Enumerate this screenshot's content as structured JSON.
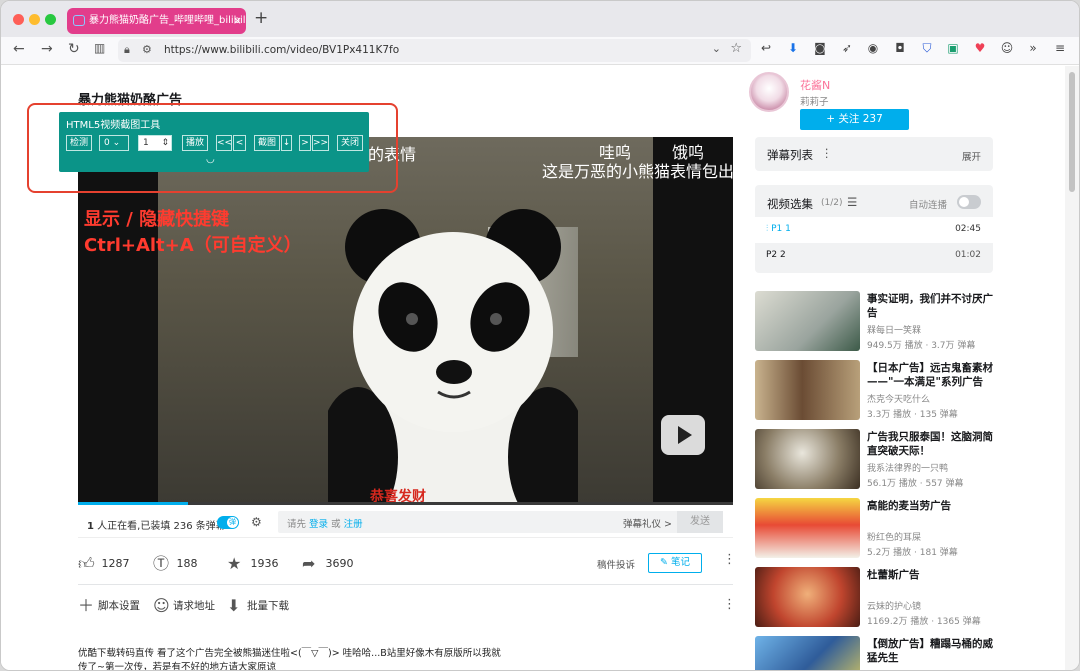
{
  "browser": {
    "tab_title": "暴力熊猫奶酪广告_哔哩哔哩_bilibili",
    "tab_close": "×",
    "new_tab": "+",
    "url": "https://www.bilibili.com/video/BV1Px411K7fo"
  },
  "video": {
    "title": "暴力熊猫奶酪广告",
    "subtitles": {
      "top_mid": "哇呜",
      "top_right": "饿呜",
      "line": "这是万恶的小熊猫表情包出",
      "left_partial": "的表情"
    },
    "hint_line1": "显示 / 隐藏快捷键",
    "hint_line2": "Ctrl+Alt+A（可自定义）",
    "danmaku": "恭喜发财"
  },
  "tool": {
    "title": "HTML5视频截图工具",
    "detect": "检测",
    "select_value": "0",
    "step_value": "1",
    "play": "播放",
    "prev2": "<<",
    "prev1": "<",
    "capture": "截图",
    "down": "↓",
    "next1": ">",
    "next2": ">>",
    "close": "关闭"
  },
  "player_bar": {
    "watching_prefix": "1",
    "watching_text": " 人正在看,已装填 236 条弹幕",
    "input_pre": "请先",
    "login": "登录",
    "or": "或",
    "register": "注册",
    "gift": "弹幕礼仪 >",
    "send": "发送"
  },
  "stats": {
    "like": "1287",
    "coin": "188",
    "fav": "1936",
    "share": "3690",
    "report": "稿件投诉",
    "note": "笔记"
  },
  "extra": {
    "script": "脚本设置",
    "request": "请求地址",
    "batch": "批量下载"
  },
  "description": "优酷下载转码直传 看了这个广告完全被熊猫迷住啦<(￣▽￣)> 哇哈哈...B站里好像木有原版所以我就传了~第一次传，若是有不好的地方请大家原谅",
  "up": {
    "name": "花酱N",
    "sub": "莉莉子",
    "follow": "+ 关注 237"
  },
  "danmaku_list": {
    "title": "弹幕列表",
    "expand": "展开"
  },
  "episodes": {
    "title": "视频选集",
    "count": "(1/2)",
    "autoplay": "自动连播",
    "items": [
      {
        "label": "P1  1",
        "duration": "02:45"
      },
      {
        "label": "P2  2",
        "duration": "01:02"
      }
    ]
  },
  "recommend": [
    {
      "title": "事实证明，我们并不讨厌广告",
      "up": "槑每日一笑槑",
      "stat": "949.5万 播放 · 3.7万 弹幕",
      "color": "#c8c6b8"
    },
    {
      "title": "【日本广告】远古鬼畜素材——\"一本满足\"系列广告",
      "up": "杰克今天吃什么",
      "stat": "3.3万 播放 · 135 弹幕",
      "color": "#8a6a4a"
    },
    {
      "title": "广告我只服泰国！这脑洞简直突破天际！",
      "up": "我系法律界的一只鸭",
      "stat": "56.1万 播放 · 557 弹幕",
      "color": "#7a6b55"
    },
    {
      "title": "高能的麦当劳广告",
      "up": "粉红色的耳屎",
      "stat": "5.2万 播放 · 181 弹幕",
      "color": "#d04030"
    },
    {
      "title": "杜蕾斯广告",
      "up": "云妹的护心镜",
      "stat": "1169.2万 播放 · 1365 弹幕",
      "color": "#b03a2e"
    },
    {
      "title": "【倒放广告】糟蹋马桶的威猛先生",
      "up": "",
      "stat": "",
      "color": "#3a7ac0"
    }
  ]
}
